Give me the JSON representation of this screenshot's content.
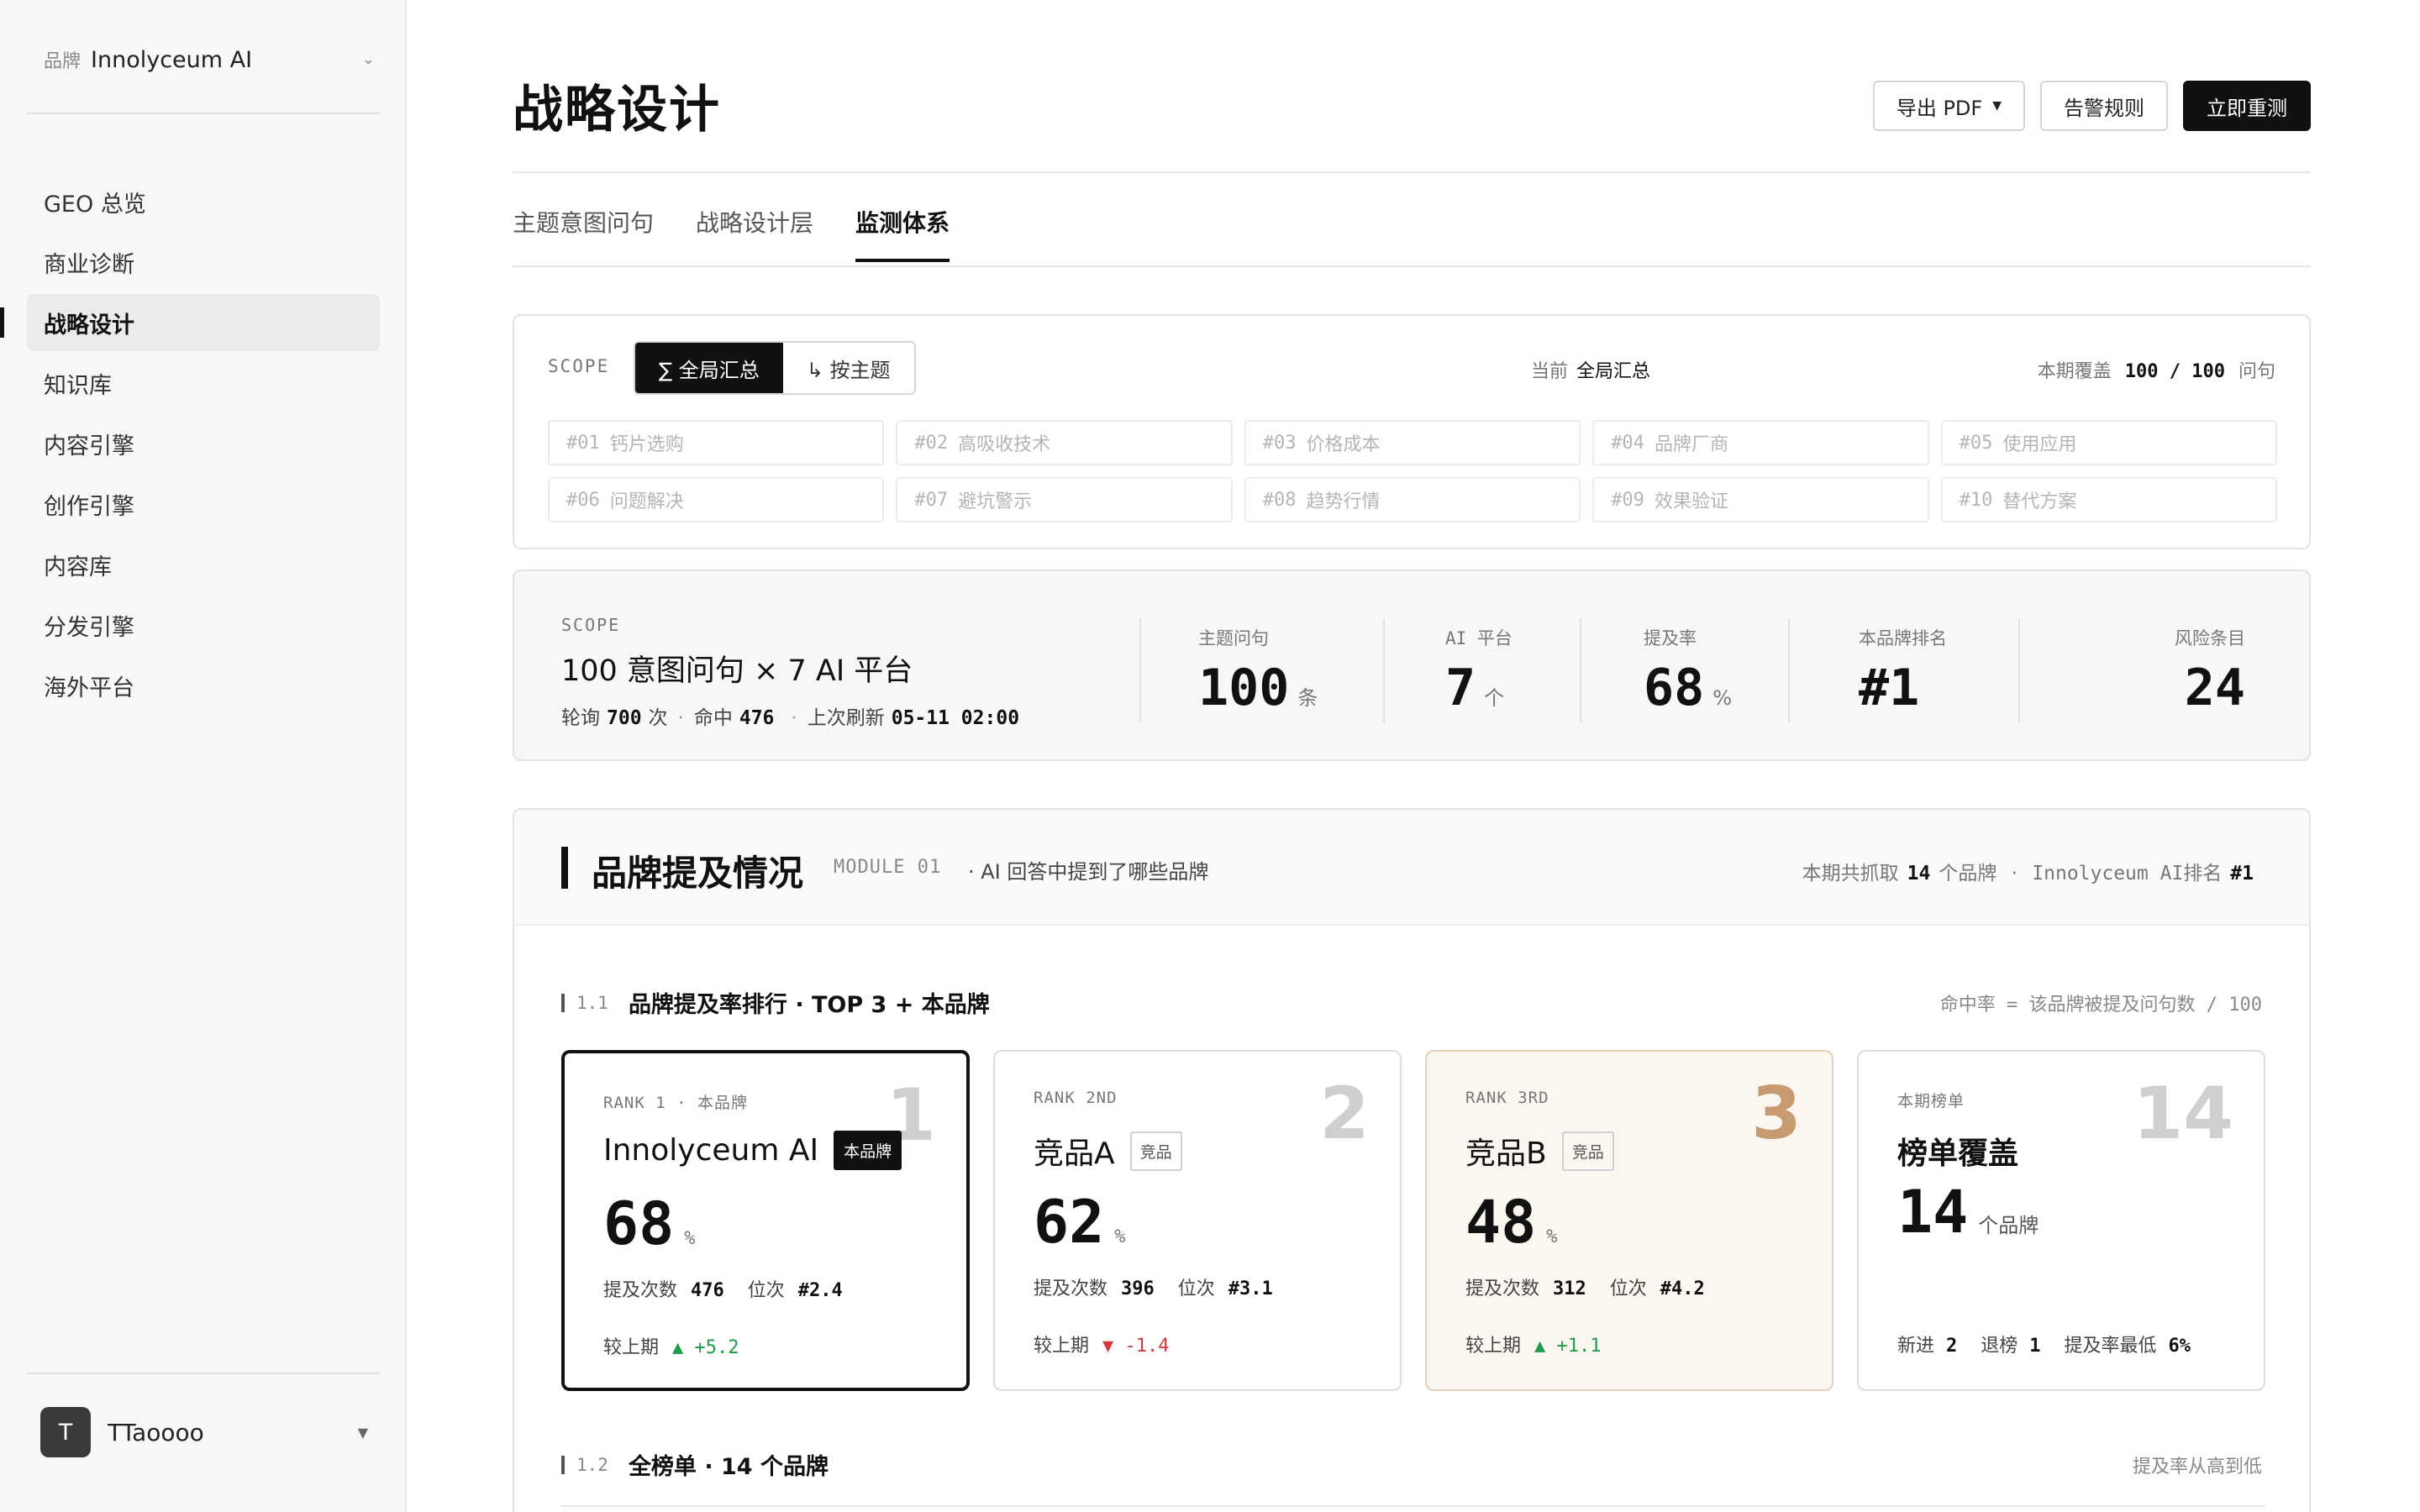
{
  "sidebar": {
    "brand_label": "品牌",
    "brand_value": "Innolyceum AI",
    "brand_chevron": "⌄",
    "items": [
      {
        "label": "GEO 总览"
      },
      {
        "label": "商业诊断"
      },
      {
        "label": "战略设计",
        "active": true
      },
      {
        "label": "知识库"
      },
      {
        "label": "内容引擎"
      },
      {
        "label": "创作引擎"
      },
      {
        "label": "内容库"
      },
      {
        "label": "分发引擎"
      },
      {
        "label": "海外平台"
      }
    ],
    "user": {
      "initial": "T",
      "name": "TTaoooo"
    }
  },
  "header": {
    "title": "战略设计",
    "export_label": "导出 PDF",
    "alert_label": "告警规则",
    "rerun_label": "立即重测"
  },
  "tabs": [
    {
      "label": "主题意图问句"
    },
    {
      "label": "战略设计层"
    },
    {
      "label": "监测体系",
      "active": true
    }
  ],
  "scope": {
    "label": "SCOPE",
    "seg_all": "∑ 全局汇总",
    "seg_topic": "↳ 按主题",
    "current_label": "当前",
    "current_value": "全局汇总",
    "cover_label": "本期覆盖",
    "cover_value": "100 / 100",
    "cover_unit": "问句",
    "topics": [
      {
        "num": "#01",
        "name": "钙片选购"
      },
      {
        "num": "#02",
        "name": "高吸收技术"
      },
      {
        "num": "#03",
        "name": "价格成本"
      },
      {
        "num": "#04",
        "name": "品牌厂商"
      },
      {
        "num": "#05",
        "name": "使用应用"
      },
      {
        "num": "#06",
        "name": "问题解决"
      },
      {
        "num": "#07",
        "name": "避坑警示"
      },
      {
        "num": "#08",
        "name": "趋势行情"
      },
      {
        "num": "#09",
        "name": "效果验证"
      },
      {
        "num": "#10",
        "name": "替代方案"
      }
    ]
  },
  "stats": {
    "scope_label": "SCOPE",
    "headline": "100 意图问句 × 7 AI 平台",
    "poll_label": "轮询",
    "poll_value": "700",
    "poll_unit": "次",
    "hit_label": "命中",
    "hit_value": "476",
    "refresh_label": "上次刷新",
    "refresh_value": "05-11 02:00",
    "sep": "·",
    "items": [
      {
        "key": "主题问句",
        "value": "100",
        "unit": "条"
      },
      {
        "key": "AI 平台",
        "value": "7",
        "unit": "个"
      },
      {
        "key": "提及率",
        "value": "68",
        "unit": "%"
      },
      {
        "key": "本品牌排名",
        "value": "#1",
        "unit": ""
      },
      {
        "key": "风险条目",
        "value": "24",
        "unit": ""
      }
    ]
  },
  "module": {
    "title": "品牌提及情况",
    "code": "MODULE 01",
    "desc": "· AI 回答中提到了哪些品牌",
    "meta_prefix": "本期共抓取",
    "meta_count": "14",
    "meta_unit": "个品牌",
    "meta_sep": "·",
    "meta_brand": "Innolyceum AI排名",
    "meta_rank": "#1",
    "sub1": {
      "num": "1.1",
      "title": "品牌提及率排行 · TOP 3 + 本品牌",
      "right": "命中率 = 该品牌被提及问句数 / 100"
    },
    "sub2": {
      "num": "1.2",
      "title": "全榜单 · 14 个品牌",
      "right": "提及率从高到低"
    },
    "cards": [
      {
        "rank": "RANK 1 · 本品牌",
        "big": "1",
        "name": "Innolyceum AI",
        "tag": "本品牌",
        "pct": "68",
        "unit": "%",
        "mention_label": "提及次数",
        "mention": "476",
        "pos_label": "位次",
        "pos": "#2.4",
        "delta_label": "较上期",
        "delta": "▲ +5.2"
      },
      {
        "rank": "RANK 2ND",
        "big": "2",
        "name": "竞品A",
        "tag": "竞品",
        "pct": "62",
        "unit": "%",
        "mention_label": "提及次数",
        "mention": "396",
        "pos_label": "位次",
        "pos": "#3.1",
        "delta_label": "较上期",
        "delta": "▼ -1.4"
      },
      {
        "rank": "RANK 3RD",
        "big": "3",
        "name": "竞品B",
        "tag": "竞品",
        "pct": "48",
        "unit": "%",
        "mention_label": "提及次数",
        "mention": "312",
        "pos_label": "位次",
        "pos": "#4.2",
        "delta_label": "较上期",
        "delta": "▲ +1.1"
      }
    ],
    "cover_card": {
      "label": "本期榜单",
      "big": "14",
      "title": "榜单覆盖",
      "value": "14",
      "unit": "个品牌",
      "new_label": "新进",
      "new_value": "2",
      "out_label": "退榜",
      "out_value": "1",
      "min_label": "提及率最低",
      "min_value": "6%"
    }
  }
}
